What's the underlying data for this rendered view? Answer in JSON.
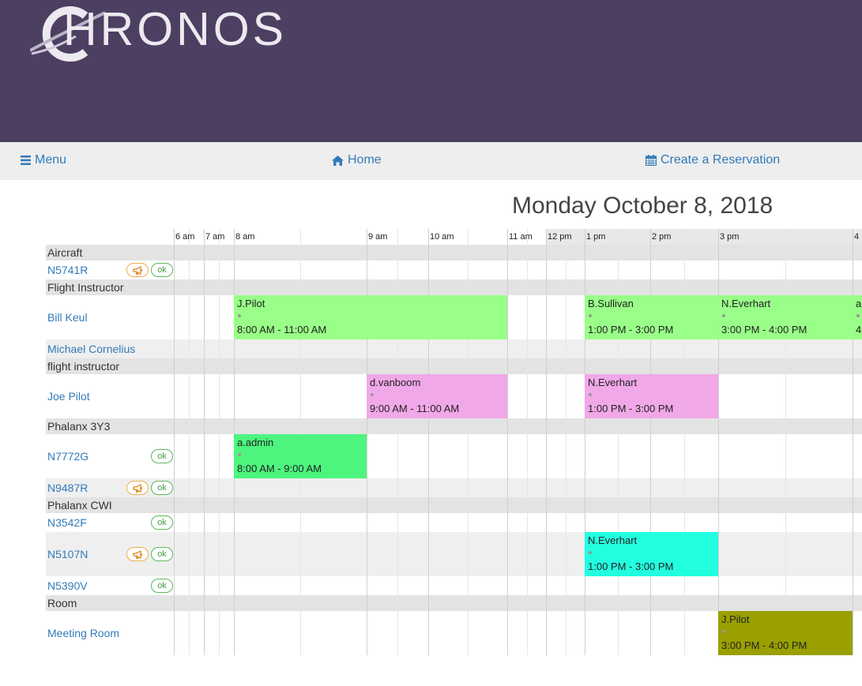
{
  "brand": {
    "name": "HRONOS",
    "header_color": "#4d3f62"
  },
  "nav": {
    "menu": "Menu",
    "home": "Home",
    "create": "Create a Reservation"
  },
  "date_title": "Monday October 8, 2018",
  "time_ticks": [
    "6 am",
    "7 am",
    "8 am",
    "9 am",
    "10 am",
    "11 am",
    "12 pm",
    "1 pm",
    "2 pm",
    "3 pm",
    "4"
  ],
  "rows": [
    {
      "kind": "category",
      "label": "Aircraft"
    },
    {
      "kind": "resource",
      "label": "N5741R",
      "badges": [
        "warn",
        "ok"
      ]
    },
    {
      "kind": "category",
      "label": "Flight Instructor"
    },
    {
      "kind": "resource",
      "label": "Bill Keul",
      "badges": []
    },
    {
      "kind": "resource",
      "label": "Michael Cornelius",
      "badges": []
    },
    {
      "kind": "category",
      "label": "flight instructor"
    },
    {
      "kind": "resource",
      "label": "Joe Pilot",
      "badges": []
    },
    {
      "kind": "category",
      "label": "Phalanx 3Y3"
    },
    {
      "kind": "resource",
      "label": "N7772G",
      "badges": [
        "ok"
      ]
    },
    {
      "kind": "resource",
      "label": "N9487R",
      "badges": [
        "warn",
        "ok"
      ]
    },
    {
      "kind": "category",
      "label": "Phalanx CWI"
    },
    {
      "kind": "resource",
      "label": "N3542F",
      "badges": [
        "ok"
      ]
    },
    {
      "kind": "resource",
      "label": "N5107N",
      "badges": [
        "warn",
        "ok"
      ]
    },
    {
      "kind": "resource",
      "label": "N5390V",
      "badges": [
        "ok"
      ]
    },
    {
      "kind": "category",
      "label": "Room"
    },
    {
      "kind": "resource",
      "label": "Meeting Room",
      "badges": []
    }
  ],
  "badge_text": {
    "ok": "ok"
  },
  "events": [
    {
      "row": 3,
      "who": "J.Pilot",
      "time": "8:00 AM - 11:00 AM",
      "start": 8,
      "end": 11,
      "color": "#99ff88"
    },
    {
      "row": 3,
      "who": "B.Sullivan",
      "time": "1:00 PM - 3:00 PM",
      "start": 13,
      "end": 15,
      "color": "#99ff88"
    },
    {
      "row": 3,
      "who": "N.Everhart",
      "time": "3:00 PM - 4:00 PM",
      "start": 15,
      "end": 16,
      "color": "#99ff88"
    },
    {
      "row": 3,
      "who": "a",
      "time": "4",
      "start": 16,
      "end": 17,
      "color": "#99ff88"
    },
    {
      "row": 6,
      "who": "d.vanboom",
      "time": "9:00 AM - 11:00 AM",
      "start": 9,
      "end": 11,
      "color": "#f1a8e8"
    },
    {
      "row": 6,
      "who": "N.Everhart",
      "time": "1:00 PM - 3:00 PM",
      "start": 13,
      "end": 15,
      "color": "#f1a8e8"
    },
    {
      "row": 8,
      "who": "a.admin",
      "time": "8:00 AM - 9:00 AM",
      "start": 8,
      "end": 9,
      "color": "#4df57f"
    },
    {
      "row": 12,
      "who": "N.Everhart",
      "time": "1:00 PM - 3:00 PM",
      "start": 13,
      "end": 15,
      "color": "#22ffe0"
    },
    {
      "row": 15,
      "who": "J.Pilot",
      "time": "3:00 PM - 4:00 PM",
      "start": 15,
      "end": 16,
      "color": "#99a000"
    }
  ]
}
